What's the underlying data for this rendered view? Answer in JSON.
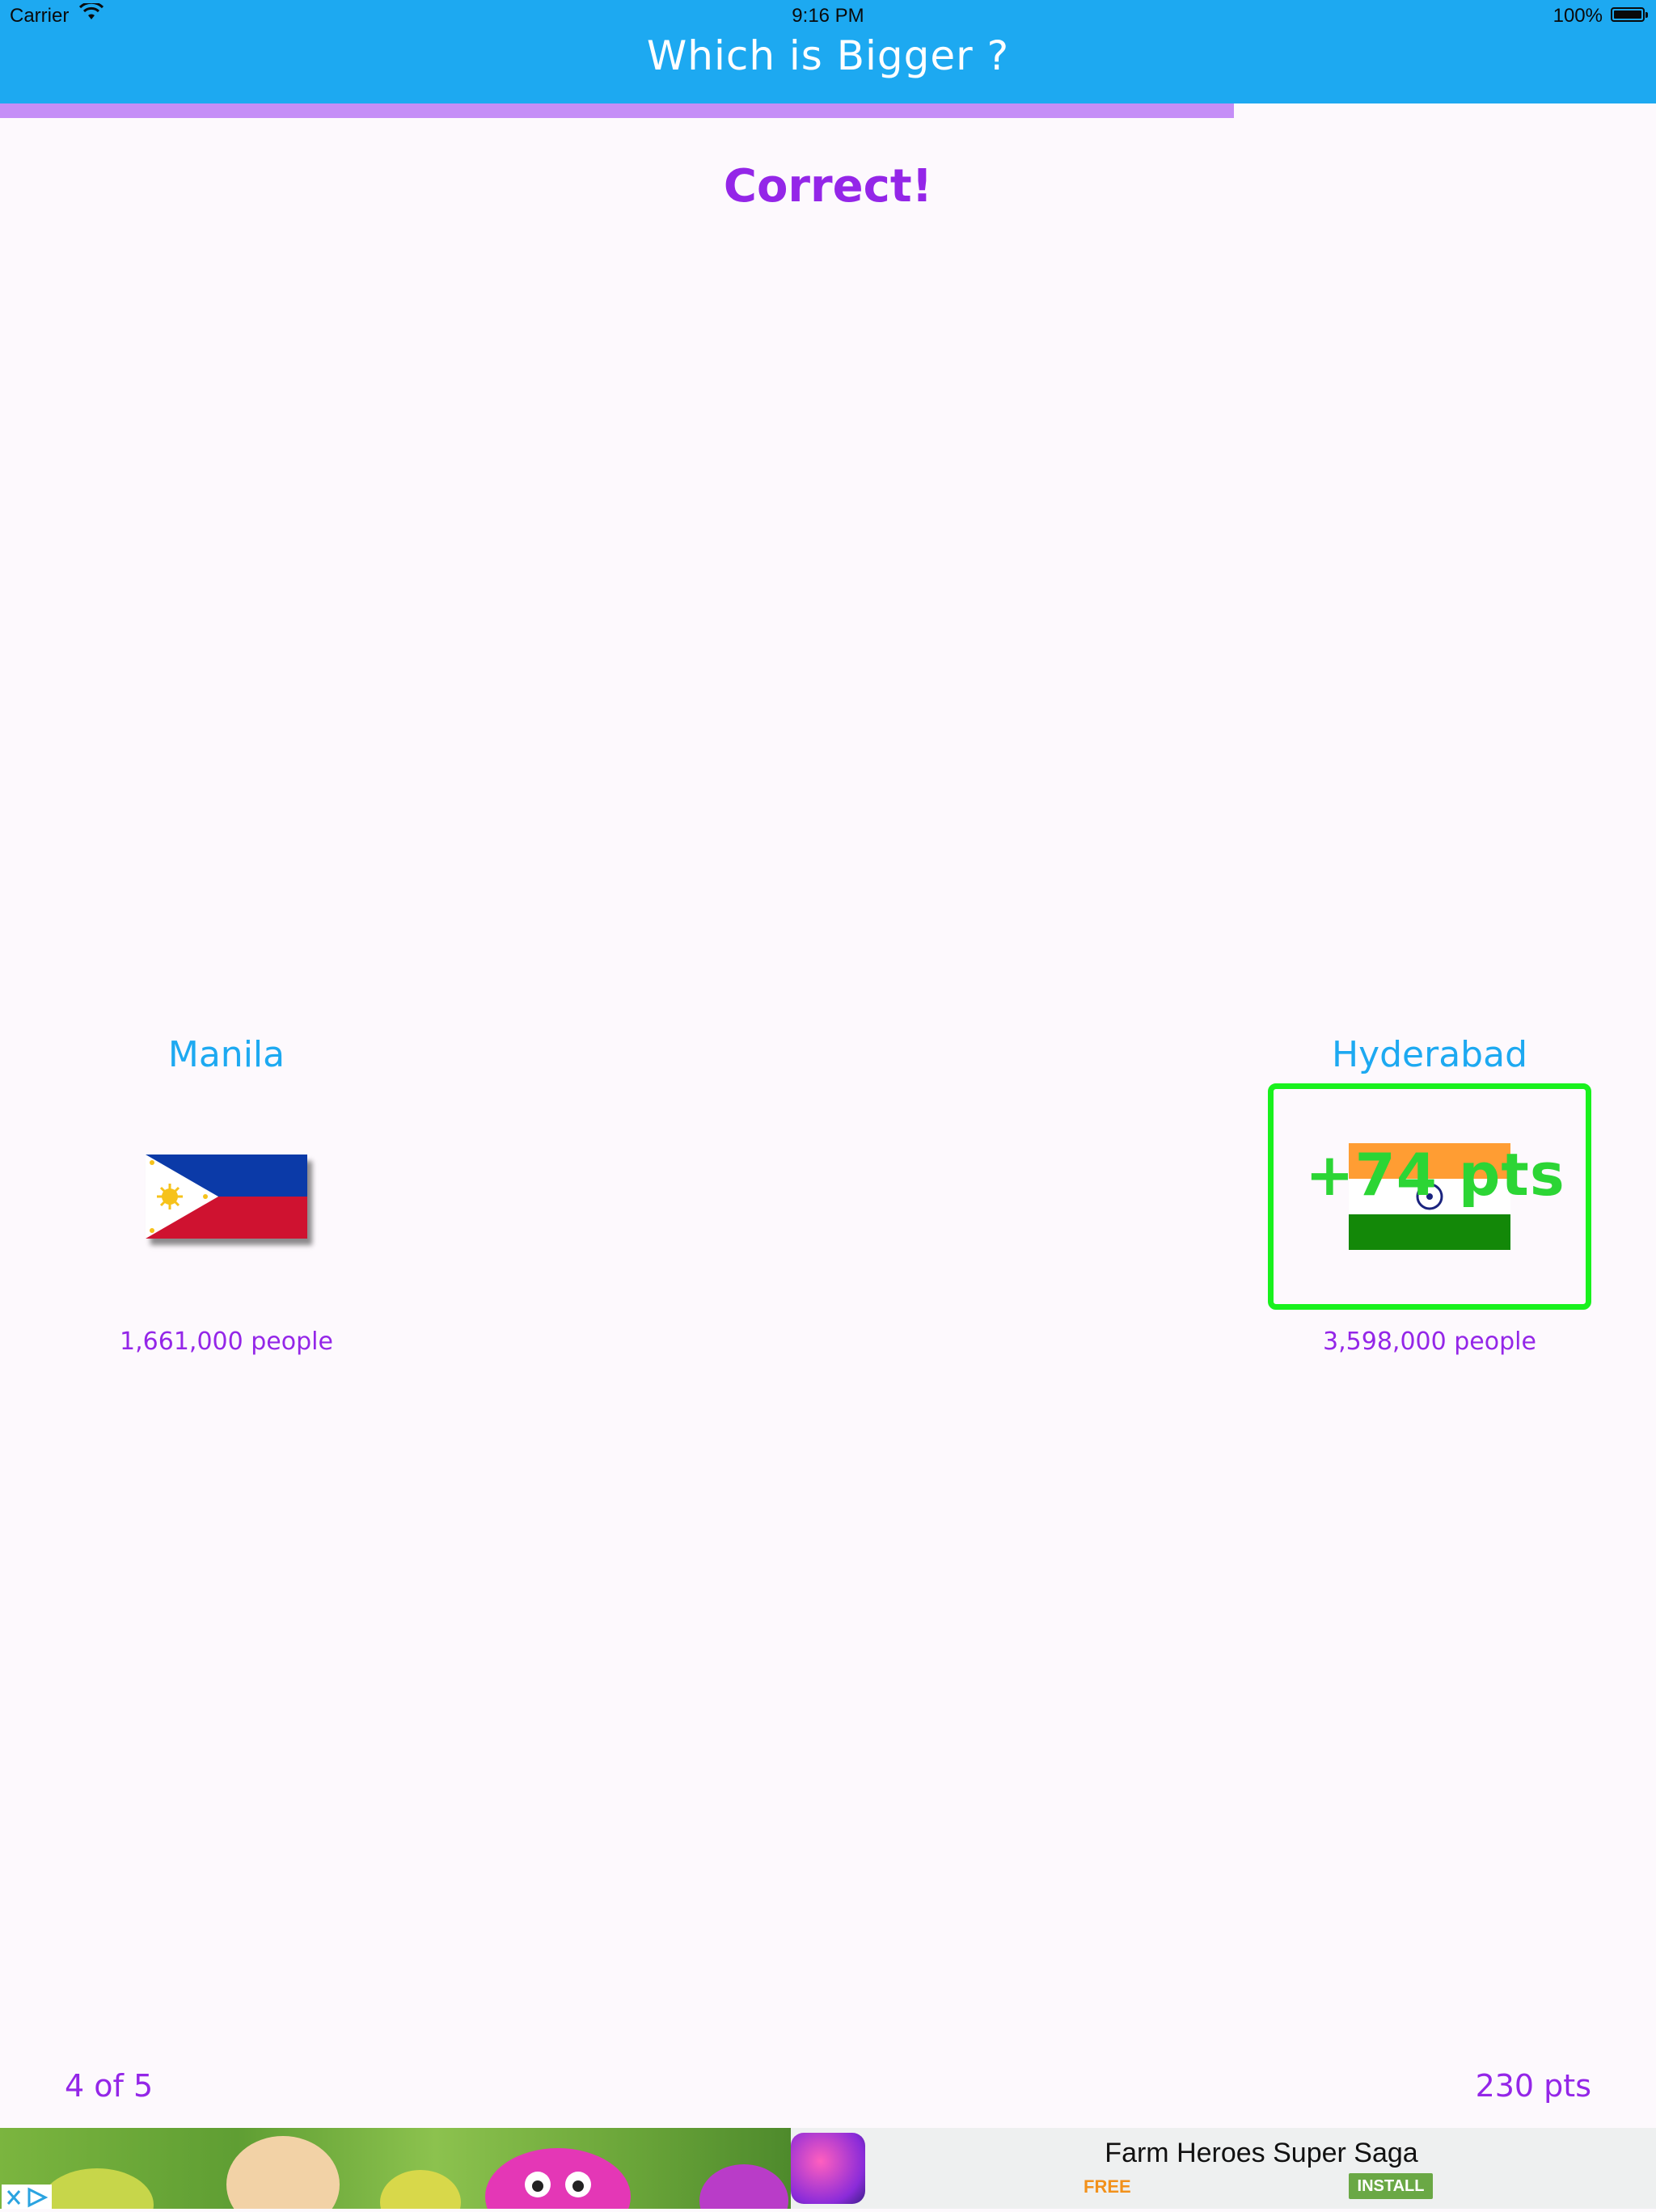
{
  "status_bar": {
    "carrier": "Carrier",
    "time": "9:16 PM",
    "battery": "100%"
  },
  "nav": {
    "title": "Which is Bigger ?"
  },
  "progress": {
    "fraction": 0.745
  },
  "feedback": "Correct!",
  "choices": [
    {
      "city": "Manila",
      "flag_icon": "philippines-flag",
      "population": "1,661,000 people"
    },
    {
      "city": "Hyderabad",
      "flag_icon": "india-flag",
      "population": "3,598,000 people",
      "points_awarded": "+74 pts",
      "selected": true
    }
  ],
  "footer": {
    "question_counter": "4 of 5",
    "score": "230 pts"
  },
  "ad": {
    "app_name": "Farm Heroes Super Saga",
    "price": "FREE",
    "install_label": "INSTALL",
    "icon": "ad-app-icon"
  },
  "colors": {
    "nav": "#1da9f1",
    "accent_purple": "#9426e8",
    "progress": "#c58ef7",
    "correct_green": "#19f11d"
  }
}
